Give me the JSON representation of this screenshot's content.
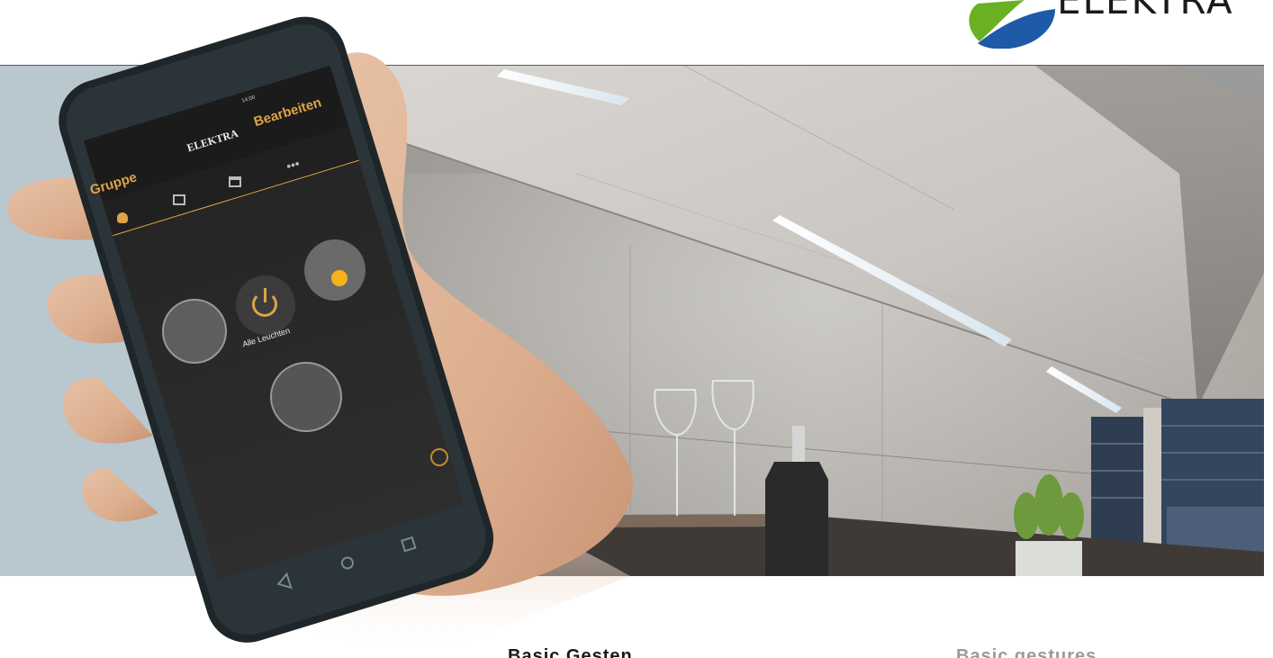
{
  "brand": {
    "name": "ELEKTRA",
    "colors": {
      "green": "#6ab023",
      "blue": "#1d5aa8",
      "text": "#1a1a1a"
    }
  },
  "phone_app": {
    "title": "ELEKTRA",
    "edit_label": "Bearbeiten",
    "group_label": "Gruppe",
    "status_time": "14:00",
    "tabs": [
      {
        "icon": "bulb-icon"
      },
      {
        "icon": "grid-icon"
      },
      {
        "icon": "scene-icon"
      },
      {
        "icon": "more-icon"
      }
    ],
    "devices": [
      {
        "icon": "light-bar-icon"
      },
      {
        "label": "Alle Leuchten",
        "icon": "power-icon"
      },
      {
        "icon": "dimmer-icon"
      },
      {
        "icon": "led-strip-icon"
      }
    ],
    "accent_color": "#e0a347"
  },
  "headings": {
    "german": "Basic Gesten",
    "english": "Basic gestures"
  }
}
